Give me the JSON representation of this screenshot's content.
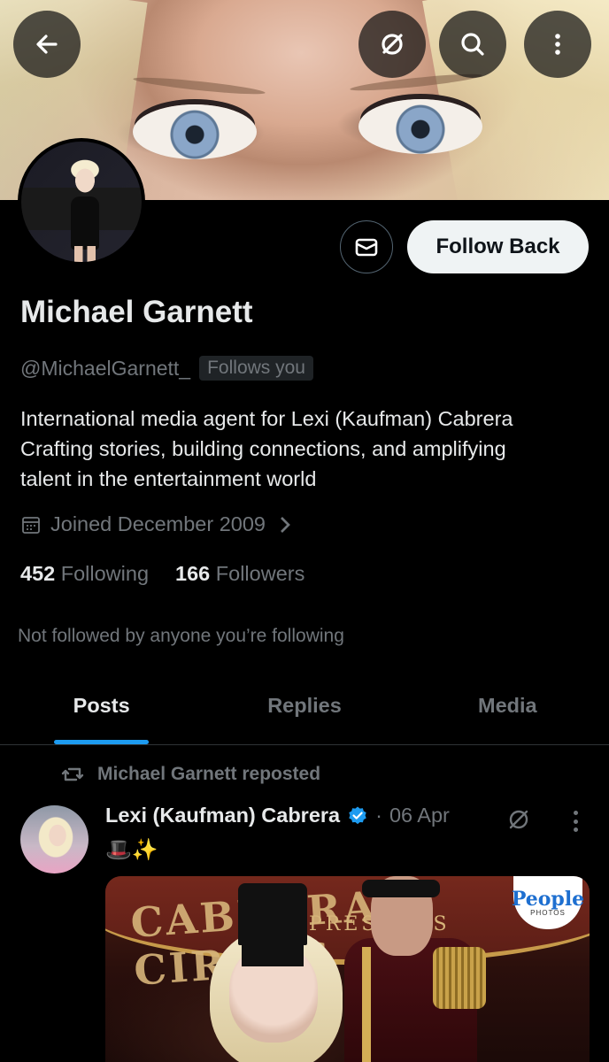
{
  "profile": {
    "name": "Michael Garnett",
    "handle": "@MichaelGarnett_",
    "follows_you_badge": "Follows you",
    "bio_lines": [
      "International media agent for Lexi (Kaufman) Cabrera",
      "Crafting stories, building connections, and amplifying",
      "talent in the entertainment world"
    ],
    "joined": "Joined December 2009",
    "following_count": "452",
    "following_label": "Following",
    "followers_count": "166",
    "followers_label": "Followers",
    "not_followed_note": "Not followed by anyone you’re following"
  },
  "actions": {
    "follow_back_label": "Follow Back",
    "back_icon": "arrow-left-icon",
    "grok_icon": "grok-icon",
    "search_icon": "search-icon",
    "more_icon": "more-vertical-icon",
    "message_icon": "envelope-icon"
  },
  "tabs": [
    {
      "label": "Posts",
      "active": true
    },
    {
      "label": "Replies",
      "active": false
    },
    {
      "label": "Media",
      "active": false
    }
  ],
  "post": {
    "repost_label": "Michael Garnett reposted",
    "author_name": "Lexi (Kaufman) Cabrera",
    "separator": "·",
    "date": "06 Apr",
    "text": "🎩✨",
    "media": {
      "banner_text": "CABRERA CIRCUS",
      "subtext": "PRESENTS",
      "badge_title": "People",
      "badge_sub": "PHOTOS"
    }
  },
  "colors": {
    "background": "#000000",
    "primary_text": "#e7e9ea",
    "secondary_text": "#71767b",
    "accent_blue": "#1d9bf0",
    "follow_button_bg": "#eff3f4"
  }
}
